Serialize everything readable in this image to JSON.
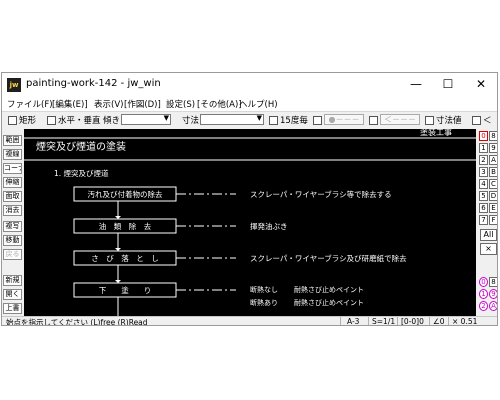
{
  "window": {
    "title": "painting-work-142 - jw_win",
    "icon_label": "jw",
    "minimize_glyph": "—",
    "maximize_glyph": "☐",
    "close_glyph": "✕"
  },
  "menu": [
    "ファイル(F)",
    "[編集(E)]",
    "表示(V)",
    "[作図(D)]",
    "設定(S)",
    "[その他(A)]",
    "ヘルプ(H)"
  ],
  "toolbar": {
    "rect_label": "矩形",
    "horiz_vert_label": "水平・垂直",
    "tilt_label": "傾き",
    "dimension_label": "寸法",
    "degree15_label": "15度毎",
    "dim_value_label": "寸法値",
    "dots_button": "●－－－",
    "arrow_button": "＜－－－",
    "lt_label": "＜"
  },
  "left_tools": [
    "範囲",
    "複線",
    "コーナー",
    "伸縮",
    "面取",
    "消去",
    "複写",
    "移動",
    "戻る",
    "新規",
    "開く",
    "上書"
  ],
  "right_layers": [
    "0",
    "8",
    "1",
    "9",
    "2",
    "A",
    "3",
    "B",
    "4",
    "C",
    "5",
    "D",
    "6",
    "E",
    "7",
    "F"
  ],
  "right_extra": {
    "all_label": "All",
    "x_label": "×",
    "layer_groups": [
      "0",
      "8",
      "1",
      "9",
      "2",
      "A"
    ]
  },
  "drawing": {
    "top_fragment": "塗装工事",
    "heading": "煙突及び煙道の塗装",
    "section": "1. 煙突及び煙道",
    "steps": [
      {
        "label": "汚れ及び付着物の除去",
        "note": "スクレーパ・ワイヤーブラシ等で除去する"
      },
      {
        "label": "油　類　除　去",
        "note": "揮発油ぶき"
      },
      {
        "label": "さ　び　落　と　し",
        "note": "スクレーパ・ワイヤーブラシ及び研磨紙で除去"
      },
      {
        "label": "下　　塗　　り",
        "note": "",
        "subnotes": [
          {
            "cond": "断熱なし",
            "text": "耐熱さび止めペイント"
          },
          {
            "cond": "断熱あり",
            "text": "耐熱さび止めペイント"
          }
        ]
      }
    ]
  },
  "status": {
    "message": "始点を指示してください (L)free (R)Read",
    "paper": "A-3",
    "scale": "S=1/1",
    "layer": "[0-0]0",
    "angle": "∠0",
    "zoom": "× 0.51"
  }
}
